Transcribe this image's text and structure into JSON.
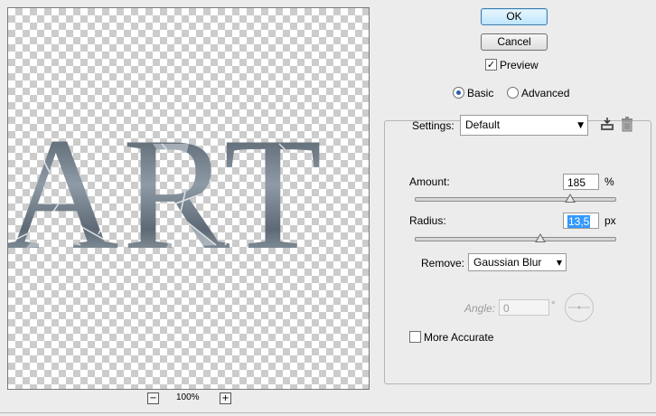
{
  "preview": {
    "art_text": "ART",
    "zoom_level": "100%",
    "zoom_out_symbol": "−",
    "zoom_in_symbol": "+"
  },
  "buttons": {
    "ok": "OK",
    "cancel": "Cancel"
  },
  "preview_checkbox": {
    "label": "Preview",
    "checked": true,
    "mark": "✓"
  },
  "mode": {
    "basic": "Basic",
    "advanced": "Advanced",
    "selected": "Basic"
  },
  "settings": {
    "label": "Settings:",
    "value": "Default",
    "save_icon": "save-preset-icon",
    "delete_icon": "trash-icon"
  },
  "amount": {
    "label": "Amount:",
    "value": "185",
    "unit": "%",
    "slider_fraction": 0.6
  },
  "radius": {
    "label": "Radius:",
    "value": "13,5",
    "unit": "px",
    "slider_fraction": 0.63
  },
  "remove": {
    "label": "Remove:",
    "value": "Gaussian Blur"
  },
  "angle": {
    "label": "Angle:",
    "value": "0",
    "unit": "°",
    "enabled": false
  },
  "more_accurate": {
    "label": "More Accurate",
    "checked": false
  },
  "colors": {
    "checker": "#cccccc",
    "letter_dark": "#4f5c67",
    "letter_light": "#c4ccd3",
    "accent": "#3399ff"
  }
}
